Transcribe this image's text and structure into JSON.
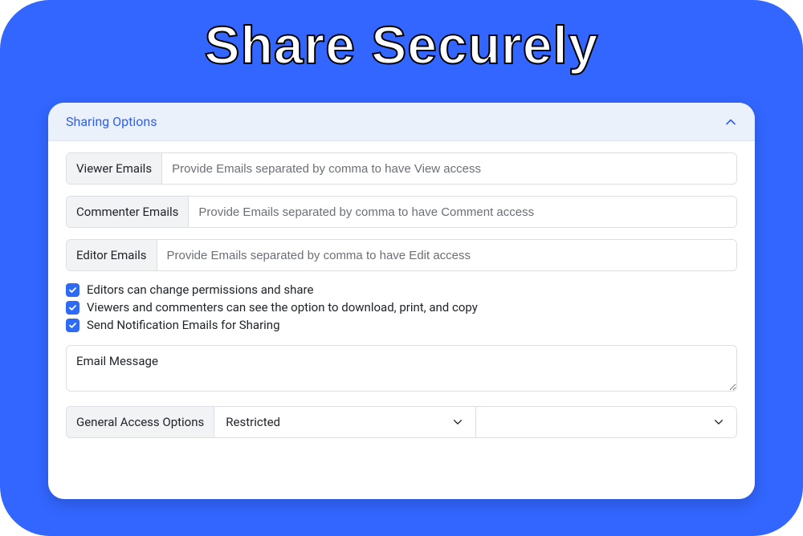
{
  "page": {
    "title": "Share Securely"
  },
  "panel": {
    "header": "Sharing Options"
  },
  "fields": {
    "viewer": {
      "label": "Viewer Emails",
      "placeholder": "Provide Emails separated by comma to have View access"
    },
    "commenter": {
      "label": "Commenter Emails",
      "placeholder": "Provide Emails separated by comma to have Comment access"
    },
    "editor": {
      "label": "Editor Emails",
      "placeholder": "Provide Emails separated by comma to have Edit access"
    }
  },
  "checks": {
    "editors_share": "Editors can change permissions and share",
    "viewers_download": "Viewers and commenters can see the option to download, print, and copy",
    "send_notification": "Send Notification Emails for Sharing"
  },
  "message": {
    "placeholder": "Email Message"
  },
  "access": {
    "label": "General Access Options",
    "selected": "Restricted",
    "secondary_selected": ""
  }
}
